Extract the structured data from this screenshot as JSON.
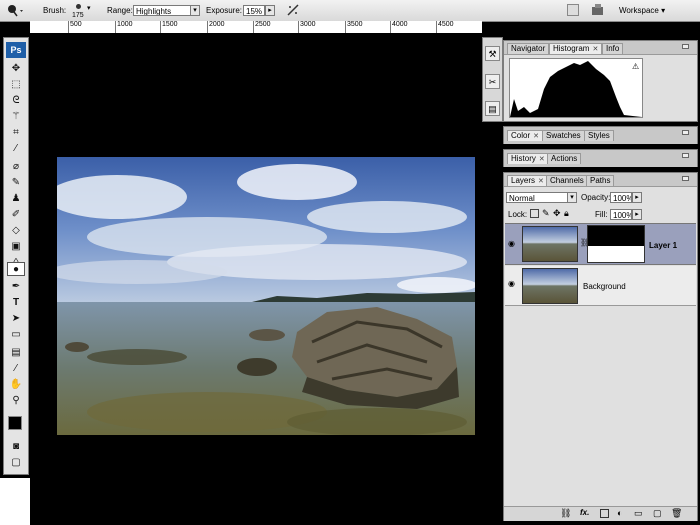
{
  "options_bar": {
    "brush_label": "Brush:",
    "brush_size": "175",
    "range_label": "Range:",
    "range_value": "Highlights",
    "exposure_label": "Exposure:",
    "exposure_value": "15%",
    "workspace_label": "Workspace ▾"
  },
  "ruler": {
    "ticks": [
      "500",
      "1000",
      "1500",
      "2000",
      "2500",
      "3000",
      "3500",
      "4000",
      "4500"
    ]
  },
  "toolbox": {
    "logo": "Ps"
  },
  "panels": {
    "nav_group": {
      "tabs": [
        "Navigator",
        "Histogram",
        "Info"
      ],
      "active": "Histogram"
    },
    "color_group": {
      "tabs": [
        "Color",
        "Swatches",
        "Styles"
      ]
    },
    "history_group": {
      "tabs": [
        "History",
        "Actions"
      ]
    },
    "layers_group": {
      "tabs": [
        "Layers",
        "Channels",
        "Paths"
      ],
      "blend_mode": "Normal",
      "opacity_label": "Opacity:",
      "opacity_value": "100%",
      "lock_label": "Lock:",
      "fill_label": "Fill:",
      "fill_value": "100%",
      "layers": [
        {
          "name": "Layer 1",
          "selected": true
        },
        {
          "name": "Background",
          "selected": false
        }
      ]
    }
  },
  "colors": {
    "selected_layer": "#9aa0bc",
    "panel_bg": "#e0e0e0",
    "canvas_bg": "#000000"
  },
  "icons": [
    "dodge-tool-icon",
    "airbrush-icon",
    "screen-mode-icon",
    "minibridge-icon"
  ]
}
